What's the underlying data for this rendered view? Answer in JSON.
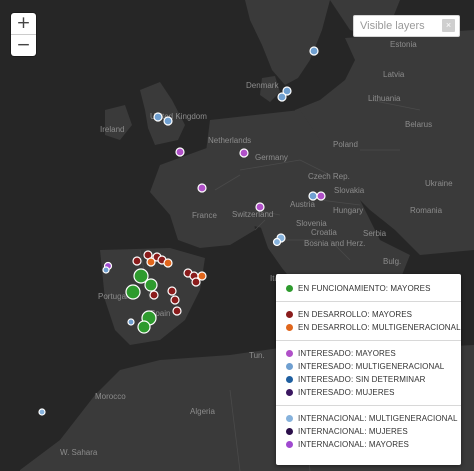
{
  "map": {
    "countries": [
      "Estonia",
      "Latvia",
      "Lithuania",
      "Denmark",
      "Ireland",
      "United Kingdom",
      "Netherlands",
      "Germany",
      "Poland",
      "Belarus",
      "Czech Rep.",
      "Slovakia",
      "Austria",
      "Hungary",
      "Slovenia",
      "Croatia",
      "Bosnia and Herz.",
      "Serbia",
      "Switzerland",
      "France",
      "Italy",
      "Portugal",
      "Spain",
      "Morocco",
      "Algeria",
      "W. Sahara",
      "Ukraine",
      "Romania"
    ],
    "background_color": "#262626",
    "land_color": "#3a3a3a",
    "sea_color": "#262626"
  },
  "zoom": {
    "in_label": "+",
    "out_label": "−"
  },
  "layer_search": {
    "placeholder": "Visible layers",
    "clear_label": "×"
  },
  "legend": {
    "groups": [
      {
        "items": [
          {
            "label": "EN FUNCIONAMIENTO: MAYORES",
            "color": "#2e9b2e"
          }
        ]
      },
      {
        "items": [
          {
            "label": "EN DESARROLLO: MAYORES",
            "color": "#8a1c1c"
          },
          {
            "label": "EN DESARROLLO: MULTIGENERACIONAL",
            "color": "#e0661c"
          }
        ]
      },
      {
        "items": [
          {
            "label": "INTERESADO: MAYORES",
            "color": "#b050c8"
          },
          {
            "label": "INTERESADO: MULTIGENERACIONAL",
            "color": "#6f9fd0"
          },
          {
            "label": "INTERESADO: SIN DETERMINAR",
            "color": "#1f5fa0"
          },
          {
            "label": "INTERESADO: MUJERES",
            "color": "#3a1760"
          }
        ]
      },
      {
        "items": [
          {
            "label": "INTERNACIONAL: MULTIGENERACIONAL",
            "color": "#86b2dc"
          },
          {
            "label": "INTERNACIONAL: MUJERES",
            "color": "#2b0f4a"
          },
          {
            "label": "INTERNACIONAL: MAYORES",
            "color": "#a04ad0"
          }
        ]
      }
    ]
  }
}
